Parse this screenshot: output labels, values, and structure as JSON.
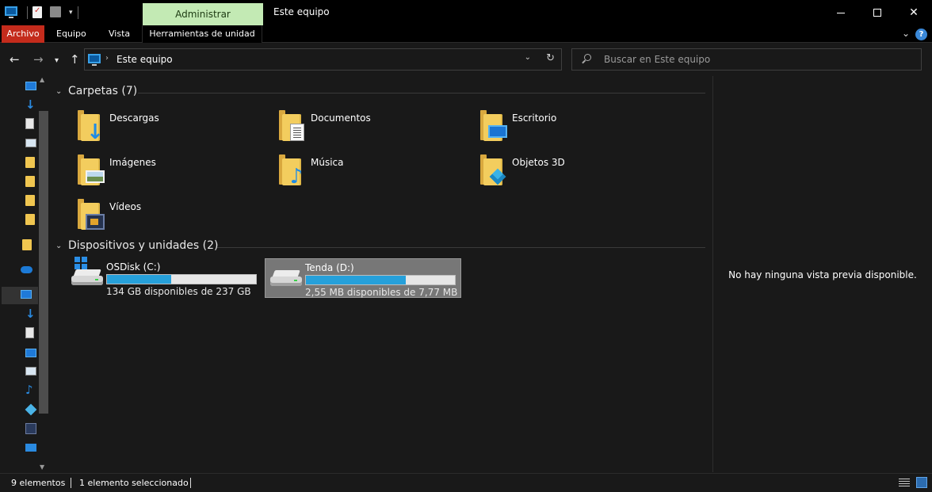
{
  "window": {
    "title": "Este equipo",
    "contextual_tab": "Administrar"
  },
  "ribbon": {
    "tabs": [
      "Archivo",
      "Equipo",
      "Vista",
      "Herramientas de unidad"
    ]
  },
  "navigation": {
    "address": "Este equipo",
    "search_placeholder": "Buscar en Este equipo"
  },
  "folders_group": {
    "title": "Carpetas (7)",
    "items": [
      {
        "label": "Descargas",
        "icon": "downloads-folder-icon"
      },
      {
        "label": "Documentos",
        "icon": "documents-folder-icon"
      },
      {
        "label": "Escritorio",
        "icon": "desktop-folder-icon"
      },
      {
        "label": "Imágenes",
        "icon": "pictures-folder-icon"
      },
      {
        "label": "Música",
        "icon": "music-folder-icon"
      },
      {
        "label": "Objetos 3D",
        "icon": "3d-objects-folder-icon"
      },
      {
        "label": "Vídeos",
        "icon": "videos-folder-icon"
      }
    ]
  },
  "drives_group": {
    "title": "Dispositivos y unidades (2)",
    "items": [
      {
        "name": "OSDisk (C:)",
        "free_text": "134 GB disponibles de 237 GB",
        "used_fraction": 0.43,
        "selected": false
      },
      {
        "name": "Tenda (D:)",
        "free_text": "2,55 MB disponibles de 7,77 MB",
        "used_fraction": 0.67,
        "selected": true
      }
    ]
  },
  "preview": {
    "message": "No hay ninguna vista previa disponible."
  },
  "status": {
    "item_count": "9 elementos",
    "selection": "1 elemento seleccionado"
  },
  "colors": {
    "accent": "#26a0da",
    "background": "#191919",
    "file_tab": "#c42b1c",
    "contextual_tab": "#c3eab4"
  }
}
